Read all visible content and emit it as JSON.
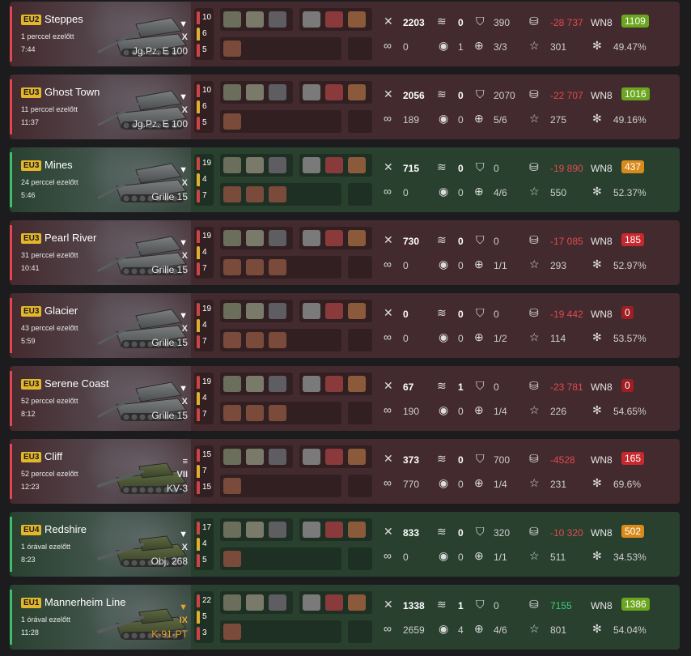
{
  "rows": [
    {
      "result": "loss",
      "region": "EU2",
      "map": "Steppes",
      "ago": "1 perccel ezelőtt",
      "duration": "7:44",
      "tier": "X",
      "tank": "Jg.Pz. E 100",
      "tier_color": "#e6e6e6",
      "shells": [
        "10",
        "6",
        "5"
      ],
      "shell_colors": [
        "#c44",
        "#e0b030",
        "#c44"
      ],
      "damage": "2203",
      "frags": "0",
      "blocked": "390",
      "assist": "0",
      "spotted": "1",
      "hits": "3/3",
      "xp": "301",
      "credits": "-28 737",
      "credits_color": "red",
      "wn8": "1109",
      "wn8_color": "#6aa61e",
      "winrate": "49.47%"
    },
    {
      "result": "loss",
      "region": "EU3",
      "map": "Ghost Town",
      "ago": "11 perccel ezelőtt",
      "duration": "11:37",
      "tier": "X",
      "tank": "Jg.Pz. E 100",
      "tier_color": "#e6e6e6",
      "shells": [
        "10",
        "6",
        "5"
      ],
      "shell_colors": [
        "#c44",
        "#e0b030",
        "#c44"
      ],
      "damage": "2056",
      "frags": "0",
      "blocked": "2070",
      "assist": "189",
      "spotted": "0",
      "hits": "5/6",
      "xp": "275",
      "credits": "-22 707",
      "credits_color": "red",
      "wn8": "1016",
      "wn8_color": "#6aa61e",
      "winrate": "49.16%"
    },
    {
      "result": "win",
      "region": "EU3",
      "map": "Mines",
      "ago": "24 perccel ezelőtt",
      "duration": "5:46",
      "tier": "X",
      "tank": "Grille 15",
      "tier_color": "#e6e6e6",
      "shells": [
        "19",
        "4",
        "7"
      ],
      "shell_colors": [
        "#c44",
        "#e0b030",
        "#c44"
      ],
      "damage": "715",
      "frags": "0",
      "blocked": "0",
      "assist": "0",
      "spotted": "0",
      "hits": "4/6",
      "xp": "550",
      "credits": "-19 890",
      "credits_color": "red",
      "wn8": "437",
      "wn8_color": "#d98a1a",
      "winrate": "52.37%"
    },
    {
      "result": "loss",
      "region": "EU3",
      "map": "Pearl River",
      "ago": "31 perccel ezelőtt",
      "duration": "10:41",
      "tier": "X",
      "tank": "Grille 15",
      "tier_color": "#e6e6e6",
      "shells": [
        "19",
        "4",
        "7"
      ],
      "shell_colors": [
        "#c44",
        "#e0b030",
        "#c44"
      ],
      "damage": "730",
      "frags": "0",
      "blocked": "0",
      "assist": "0",
      "spotted": "0",
      "hits": "1/1",
      "xp": "293",
      "credits": "-17 085",
      "credits_color": "red",
      "wn8": "185",
      "wn8_color": "#c8282e",
      "winrate": "52.97%"
    },
    {
      "result": "loss",
      "region": "EU3",
      "map": "Glacier",
      "ago": "43 perccel ezelőtt",
      "duration": "5:59",
      "tier": "X",
      "tank": "Grille 15",
      "tier_color": "#e6e6e6",
      "shells": [
        "19",
        "4",
        "7"
      ],
      "shell_colors": [
        "#c44",
        "#e0b030",
        "#c44"
      ],
      "damage": "0",
      "frags": "0",
      "blocked": "0",
      "assist": "0",
      "spotted": "0",
      "hits": "1/2",
      "xp": "114",
      "credits": "-19 442",
      "credits_color": "red",
      "wn8": "0",
      "wn8_color": "#a01e22",
      "winrate": "53.57%"
    },
    {
      "result": "loss",
      "region": "EU3",
      "map": "Serene Coast",
      "ago": "52 perccel ezelőtt",
      "duration": "8:12",
      "tier": "X",
      "tank": "Grille 15",
      "tier_color": "#e6e6e6",
      "shells": [
        "19",
        "4",
        "7"
      ],
      "shell_colors": [
        "#c44",
        "#e0b030",
        "#c44"
      ],
      "damage": "67",
      "frags": "1",
      "blocked": "0",
      "assist": "190",
      "spotted": "0",
      "hits": "1/4",
      "xp": "226",
      "credits": "-23 781",
      "credits_color": "red",
      "wn8": "0",
      "wn8_color": "#a01e22",
      "winrate": "54.65%"
    },
    {
      "result": "loss",
      "region": "EU3",
      "map": "Cliff",
      "ago": "52 perccel ezelőtt",
      "duration": "12:23",
      "tier": "VII",
      "tank": "KV-3",
      "tier_color": "#e6e6e6",
      "shells": [
        "15",
        "7",
        "15"
      ],
      "shell_colors": [
        "#c44",
        "#e0b030",
        "#c44"
      ],
      "damage": "373",
      "frags": "0",
      "blocked": "700",
      "assist": "770",
      "spotted": "0",
      "hits": "1/4",
      "xp": "231",
      "credits": "-4528",
      "credits_color": "red",
      "wn8": "165",
      "wn8_color": "#c8282e",
      "winrate": "69.6%"
    },
    {
      "result": "win",
      "region": "EU4",
      "map": "Redshire",
      "ago": "1 órával ezelőtt",
      "duration": "8:23",
      "tier": "X",
      "tank": "Obj. 268",
      "tier_color": "#e6e6e6",
      "shells": [
        "17",
        "4",
        "5"
      ],
      "shell_colors": [
        "#c44",
        "#e0b030",
        "#c44"
      ],
      "damage": "833",
      "frags": "0",
      "blocked": "320",
      "assist": "0",
      "spotted": "0",
      "hits": "1/1",
      "xp": "511",
      "credits": "-10 320",
      "credits_color": "red",
      "wn8": "502",
      "wn8_color": "#d98a1a",
      "winrate": "34.53%"
    },
    {
      "result": "win",
      "region": "EU1",
      "map": "Mannerheim Line",
      "ago": "1 órával ezelőtt",
      "duration": "11:28",
      "tier": "IX",
      "tank": "K-91-PT",
      "tier_color": "#e7a52a",
      "shells": [
        "22",
        "5",
        "3"
      ],
      "shell_colors": [
        "#c44",
        "#e0b030",
        "#c44"
      ],
      "damage": "1338",
      "frags": "1",
      "blocked": "0",
      "assist": "2659",
      "spotted": "4",
      "hits": "4/6",
      "xp": "801",
      "credits": "7155",
      "credits_color": "green",
      "wn8": "1386",
      "wn8_color": "#6aa61e",
      "winrate": "54.04%"
    }
  ],
  "labels": {
    "wn8": "WN8"
  },
  "icons": {
    "damage": "crossed-swords-icon",
    "frags": "tank-destroyed-icon",
    "blocked": "shield-icon",
    "assist": "link-icon",
    "spotted": "eye-icon",
    "hits": "crosshair-icon",
    "xp": "star-icon",
    "credits": "credits-icon",
    "winrate": "sparkle-icon"
  }
}
